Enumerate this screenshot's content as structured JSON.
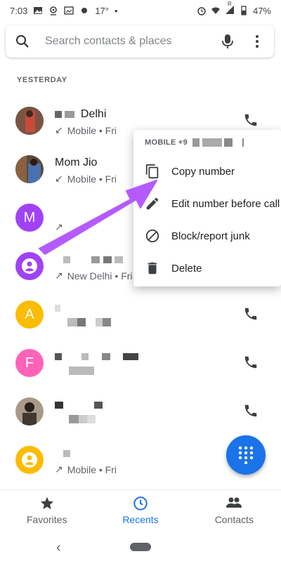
{
  "status_bar": {
    "time": "7:03",
    "temperature": "17°",
    "battery": "47%",
    "signal_badge": "R"
  },
  "search": {
    "placeholder": "Search contacts & places"
  },
  "section": {
    "label": "YESTERDAY"
  },
  "calls": [
    {
      "name": "Delhi",
      "meta": "Mobile • Fri",
      "direction": "incoming",
      "avatar_type": "photo"
    },
    {
      "name": "Mom Jio",
      "meta": "Mobile • Fri",
      "direction": "incoming",
      "avatar_type": "photo"
    },
    {
      "name": "",
      "meta": "",
      "avatar_letter": "M",
      "avatar_color": "#a142f4",
      "direction": "outgoing"
    },
    {
      "name": "",
      "meta": "New Delhi • Fri",
      "avatar_type": "person",
      "avatar_color": "#a142f4",
      "direction": "outgoing"
    },
    {
      "name": "",
      "meta": "",
      "avatar_letter": "A",
      "avatar_color": "#fbbc04"
    },
    {
      "name": "",
      "meta": "",
      "avatar_letter": "F",
      "avatar_color": "#ff63b8"
    },
    {
      "name": "",
      "meta": "",
      "avatar_type": "photo"
    },
    {
      "name": "",
      "meta": "Mobile • Fri",
      "avatar_type": "person",
      "avatar_color": "#fbbc04",
      "direction": "outgoing"
    }
  ],
  "popup": {
    "header": "MOBILE +9",
    "items": [
      {
        "label": "Copy number",
        "icon": "copy-icon"
      },
      {
        "label": "Edit number before call",
        "icon": "pencil-icon"
      },
      {
        "label": "Block/report junk",
        "icon": "block-icon"
      },
      {
        "label": "Delete",
        "icon": "trash-icon"
      }
    ]
  },
  "bottom_nav": {
    "items": [
      {
        "label": "Favorites",
        "icon": "star-icon"
      },
      {
        "label": "Recents",
        "icon": "clock-icon",
        "active": true
      },
      {
        "label": "Contacts",
        "icon": "people-icon"
      }
    ]
  },
  "colors": {
    "accent": "#1a73e8",
    "annotation_arrow": "#b45bff"
  }
}
